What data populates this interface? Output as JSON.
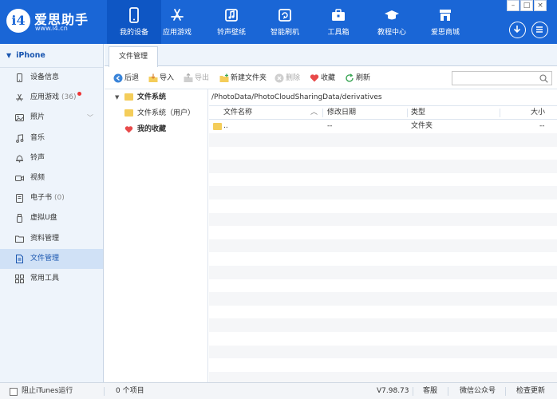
{
  "brand": {
    "name": "爱思助手",
    "url": "www.i4.cn",
    "logo_letter": "i4"
  },
  "nav": [
    {
      "label": "我的设备",
      "icon": "phone-icon"
    },
    {
      "label": "应用游戏",
      "icon": "appstore-icon"
    },
    {
      "label": "铃声壁纸",
      "icon": "music-icon"
    },
    {
      "label": "智能刷机",
      "icon": "flash-icon"
    },
    {
      "label": "工具箱",
      "icon": "toolbox-icon"
    },
    {
      "label": "教程中心",
      "icon": "graduation-icon"
    },
    {
      "label": "爱思商城",
      "icon": "store-icon"
    }
  ],
  "window_controls": {
    "minimize": "–",
    "maximize": "□",
    "close": "×"
  },
  "sidebar": {
    "device": "iPhone",
    "items": [
      {
        "label": "设备信息",
        "icon": "info-icon"
      },
      {
        "label": "应用游戏",
        "count": "(36)",
        "icon": "apps-icon"
      },
      {
        "label": "照片",
        "icon": "photo-icon"
      },
      {
        "label": "音乐",
        "icon": "music-note-icon"
      },
      {
        "label": "铃声",
        "icon": "bell-icon"
      },
      {
        "label": "视频",
        "icon": "video-icon"
      },
      {
        "label": "电子书",
        "count": "(0)",
        "icon": "ebook-icon"
      },
      {
        "label": "虚拟U盘",
        "icon": "usb-icon"
      },
      {
        "label": "资料管理",
        "icon": "folder-icon"
      },
      {
        "label": "文件管理",
        "icon": "file-icon"
      },
      {
        "label": "常用工具",
        "icon": "grid-icon"
      }
    ]
  },
  "tab": {
    "label": "文件管理"
  },
  "toolbar": {
    "back": "后退",
    "import": "导入",
    "export": "导出",
    "new_folder": "新建文件夹",
    "delete": "删除",
    "favorite": "收藏",
    "refresh": "刷新",
    "search_placeholder": ""
  },
  "tree": {
    "root": "文件系统",
    "child": "文件系统（用户）",
    "favorites": "我的收藏"
  },
  "path": "/PhotoData/PhotoCloudSharingData/derivatives",
  "columns": {
    "name": "文件名称",
    "date": "修改日期",
    "type": "类型",
    "size": "大小"
  },
  "files": [
    {
      "name": "..",
      "date": "--",
      "type": "文件夹",
      "size": "--"
    }
  ],
  "status": {
    "itunes": "阻止iTunes运行",
    "items": "0 个项目",
    "version": "V7.98.73",
    "service": "客服",
    "wechat": "微信公众号",
    "update": "检查更新"
  },
  "colors": {
    "brand_blue": "#1a66d6",
    "folder_yellow": "#f4cd5a",
    "heart_red": "#e84a4a"
  }
}
